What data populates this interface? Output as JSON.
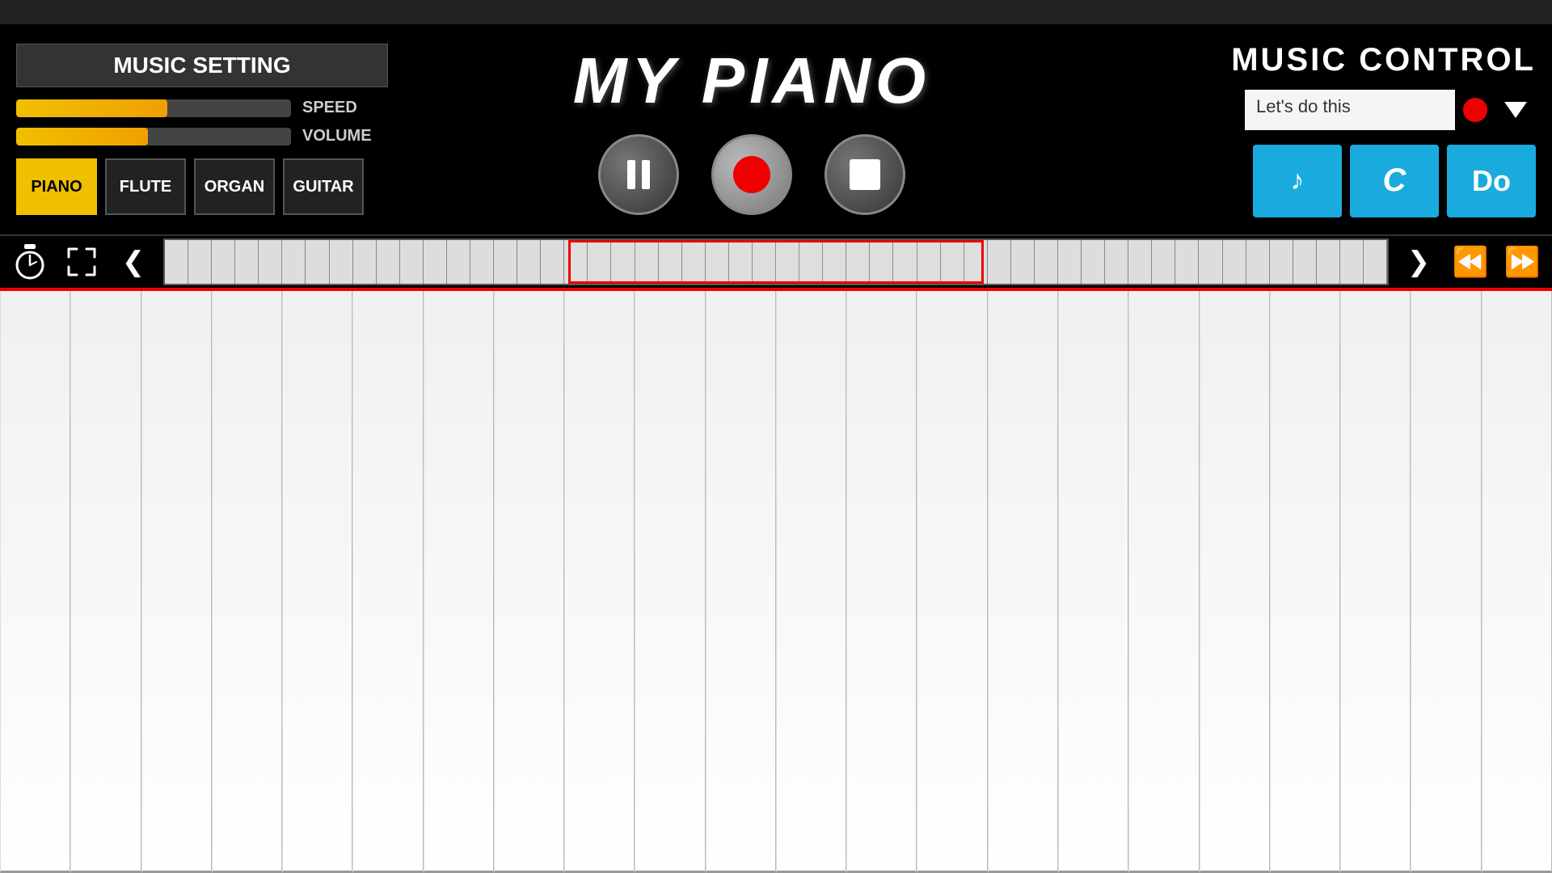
{
  "topbar": {
    "bg": "#222"
  },
  "header": {
    "music_setting_label": "MUSIC SETTING",
    "speed_label": "SPEED",
    "volume_label": "VOLUME",
    "speed_fill_pct": 55,
    "volume_fill_pct": 48,
    "instruments": [
      {
        "id": "piano",
        "label": "PIANO",
        "active": true
      },
      {
        "id": "flute",
        "label": "FLUTE",
        "active": false
      },
      {
        "id": "organ",
        "label": "ORGAN",
        "active": false
      },
      {
        "id": "guitar",
        "label": "GUITAR",
        "active": false
      }
    ],
    "app_title": "MY PIANO",
    "controls": {
      "pause_label": "Pause",
      "record_label": "Record",
      "stop_label": "Stop"
    },
    "music_control_label": "MUSIC CONTROL",
    "song_name": "Let's do this",
    "action_buttons": [
      {
        "id": "music-note",
        "label": "♪"
      },
      {
        "id": "c-note",
        "label": "C"
      },
      {
        "id": "do-note",
        "label": "Do"
      }
    ]
  },
  "navbar": {
    "timer_label": "Timer",
    "expand_label": "Expand",
    "prev_label": "Previous",
    "next_label": "Next",
    "rewind_label": "Rewind",
    "fast_forward_label": "Fast Forward"
  },
  "piano": {
    "white_keys_count": 22,
    "octaves": 3
  }
}
